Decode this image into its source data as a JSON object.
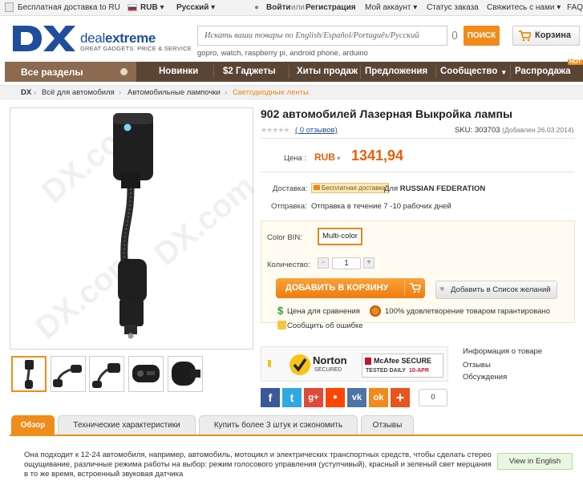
{
  "topbar": {
    "free_shipping": "Бесплатная доставка to RU",
    "currency": "RUB",
    "language": "Русский",
    "login": "Войти",
    "or": "или",
    "register": "Регистрация",
    "account": "Мой аккаунт",
    "order_status": "Статус заказа",
    "contact": "Свяжитесь с нами",
    "faq": "FAQ"
  },
  "header": {
    "logo_mark": "DX",
    "brand_deal": "deal",
    "brand_extreme": "extreme",
    "tagline": "GREAT GADGETS. PRICE & SERVICE",
    "search_placeholder": "Искать ваши товары по English/Español/Português/Русский",
    "search_button": "ПОИСК",
    "cart_label": "Корзина",
    "hints": "gopro, watch, raspberry pi, android phone, arduino"
  },
  "nav": {
    "all_sections": "Все разделы",
    "items": [
      "Новинки",
      "$2 Гаджеты",
      "Хиты продаж",
      "Предложения",
      "Сообщество",
      "Распродажа"
    ],
    "hot_badge": "HOT"
  },
  "breadcrumb": [
    "DX",
    "Всё для автомобиля",
    "Автомобильные лампочки",
    "Светодиодные ленты"
  ],
  "product": {
    "title": "902 автомобилей Лазерная Выкройка лампы",
    "reviews": "( 0 отзывов)",
    "sku_label": "SKU:",
    "sku": "303703",
    "added": "(Добавлен 26.03.2014)",
    "price_label": "Цена :",
    "currency": "RUB",
    "price": "1341,94",
    "shipping_label": "Доставка:",
    "free_badge": "Бесплатная доставка",
    "shipping_for": "Для",
    "shipping_country": "RUSSIAN FEDERATION",
    "dispatch_label": "Отправка:",
    "dispatch_value": "Отправка в течение 7 -10 рабочих дней",
    "color_label": "Color BIN:",
    "color_value": "Multi-color",
    "qty_label": "Количество:",
    "qty_minus": "-",
    "qty_value": "1",
    "qty_plus": "+",
    "add_to_cart": "ДОБАВИТЬ В КОРЗИНУ",
    "wishlist": "Добавить в Список желаний",
    "price_compare": "Цена для сравнения",
    "satisfaction": "100% удовлетворение товаром гарантировано",
    "report_error": "Сообщить об ошибке"
  },
  "trust": {
    "norton_title": "Norton",
    "norton_sub": "SECURED",
    "mcafee_title": "McAfee SECURE",
    "mcafee_sub": "TESTED DAILY",
    "mcafee_date": "10-APR"
  },
  "side_links": [
    "Информация о товаре",
    "Отзывы",
    "Обсуждения"
  ],
  "social": {
    "icons": [
      "facebook-icon",
      "twitter-icon",
      "google-plus-icon",
      "reddit-icon",
      "vk-icon",
      "odnoklassniki-icon",
      "share-plus-icon"
    ],
    "glyphs": [
      "f",
      "t",
      "g+",
      "●",
      "vk",
      "ok",
      "+"
    ],
    "colors": [
      "#3b5998",
      "#2fa9e0",
      "#dd4b39",
      "#ff4500",
      "#4c75a3",
      "#f28a1a",
      "#e8541e"
    ],
    "count": "0"
  },
  "tabs": [
    "Обзор",
    "Технические характеристики",
    "Купить более 3 штук и сэкономить",
    "Отзывы"
  ],
  "description": "Она подходит к 12-24 автомобиля, например, автомобиль, мотоцикл и электрических транспортных средств, чтобы сделать стерео ощущивание, различные режима работы на выбор: режим голосового управления (уступчивый), красный и зеленый свет мерцания в то же время, встроенный звуковая датчика",
  "view_english": "View in English",
  "watermark": "DX.com",
  "colors": {
    "accent": "#f08c1a",
    "nav_bg": "#5a4534",
    "price": "#e8600c",
    "link": "#1f4f9a"
  }
}
